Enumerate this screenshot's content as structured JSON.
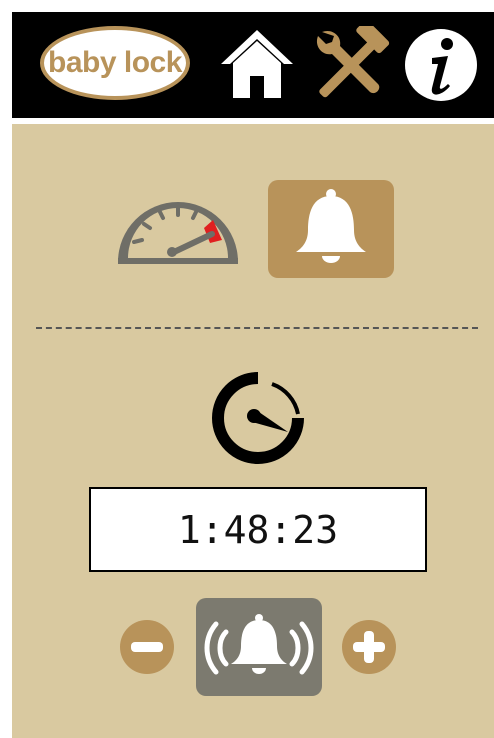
{
  "header": {
    "logo_text": "baby lock",
    "icons": [
      "home-icon",
      "tools-icon",
      "info-icon"
    ]
  },
  "mode": {
    "icons": [
      "speedometer-icon",
      "bell-icon"
    ],
    "selected": "bell-icon"
  },
  "timer": {
    "icon": "timer-icon",
    "display_value": "1:48:23"
  },
  "controls": {
    "icons": [
      "minus-icon",
      "ringing-bell-icon",
      "plus-icon"
    ]
  },
  "colors": {
    "header_background": "#000000",
    "panel_background": "#d9c9a0",
    "accent_gold": "#b8935a",
    "alarm_button_gray": "#7c7a6f",
    "gauge_red": "#e02020"
  }
}
